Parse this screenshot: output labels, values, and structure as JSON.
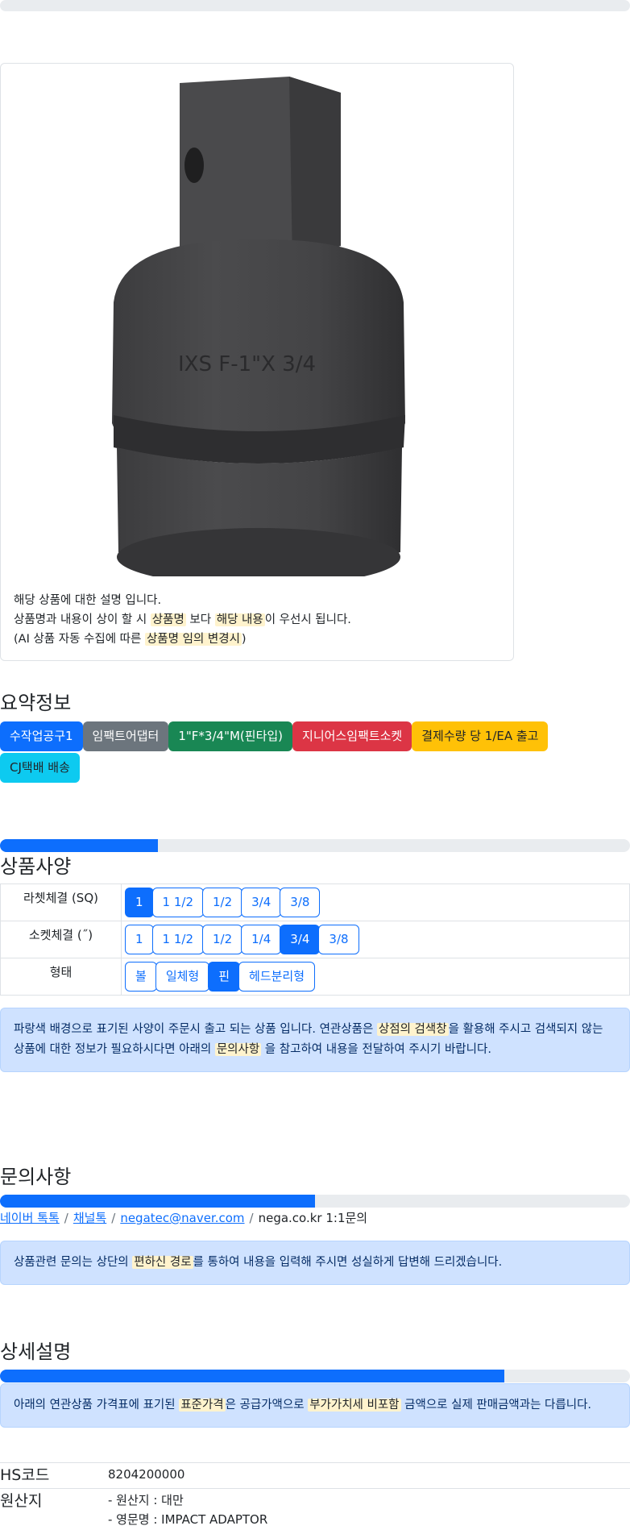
{
  "card": {
    "line1": "해당 상품에 대한 설명 입니다.",
    "line2_pre": "상품명과 내용이 상이 할 시 ",
    "line2_hl1": "상품명",
    "line2_mid": " 보다 ",
    "line2_hl2": "해당 내용",
    "line2_post": "이 우선시 됩니다.",
    "line3_pre": "(AI 상품 자동 수집에 따른 ",
    "line3_hl": "상품명 임의 변경시",
    "line3_post": ")"
  },
  "summary": {
    "title": "요약정보",
    "badges": [
      "수작업공구1",
      "임팩트어댑터",
      "1\"F*3/4\"M(핀타입)",
      "지니어스임팩트소켓",
      "결제수량 당 1/EA 출고",
      "CJ택배 배송"
    ]
  },
  "spec": {
    "title": "상품사양",
    "progress": 0.25,
    "rows": [
      {
        "label": "라쳇체결 (SQ)",
        "options": [
          "1",
          "1 1/2",
          "1/2",
          "3/4",
          "3/8"
        ],
        "selected": 0
      },
      {
        "label": "소켓체결 (˝)",
        "options": [
          "1",
          "1 1/2",
          "1/2",
          "1/4",
          "3/4",
          "3/8"
        ],
        "selected": 4
      },
      {
        "label": "형태",
        "options": [
          "볼",
          "일체형",
          "핀",
          "헤드분리형"
        ],
        "selected": 2
      }
    ],
    "note_pre": "파랑색 배경으로 표기된 사양이 주문시 출고 되는 상품 입니다. 연관상품은 ",
    "note_hl1": "상점의 검색창",
    "note_mid": "을 활용해 주시고 검색되지 않는 상품에 대한 정보가 필요하시다면 아래의 ",
    "note_hl2": "문의사항",
    "note_post": " 을 참고하여 내용을 전달하여 주시기 바랍니다."
  },
  "inquiry": {
    "title": "문의사항",
    "progress": 0.5,
    "links": [
      "네이버 톡톡",
      "채널톡",
      "negatec@naver.com"
    ],
    "last": "nega.co.kr 1:1문의",
    "note_pre": "상품관련 문의는 상단의 ",
    "note_hl": "편하신 경로",
    "note_post": "를 통하여 내용을 입력해 주시면 성실하게 답변해 드리겠습니다."
  },
  "detail": {
    "title": "상세설명",
    "progress": 0.8,
    "note_pre": "아래의 연관상품 가격표에 표기된 ",
    "note_hl1": "표준가격",
    "note_mid": "은 공급가액으로 ",
    "note_hl2": "부가가치세 비포함",
    "note_post": " 금액으로 실제 판매금액과는 다릅니다.",
    "hs_label": "HS코드",
    "hs_value": "8204200000",
    "origin_label": "원산지",
    "origin_line1": "- 원산지 : 대만",
    "origin_line2": "- 영문명 : IMPACT ADAPTOR"
  }
}
